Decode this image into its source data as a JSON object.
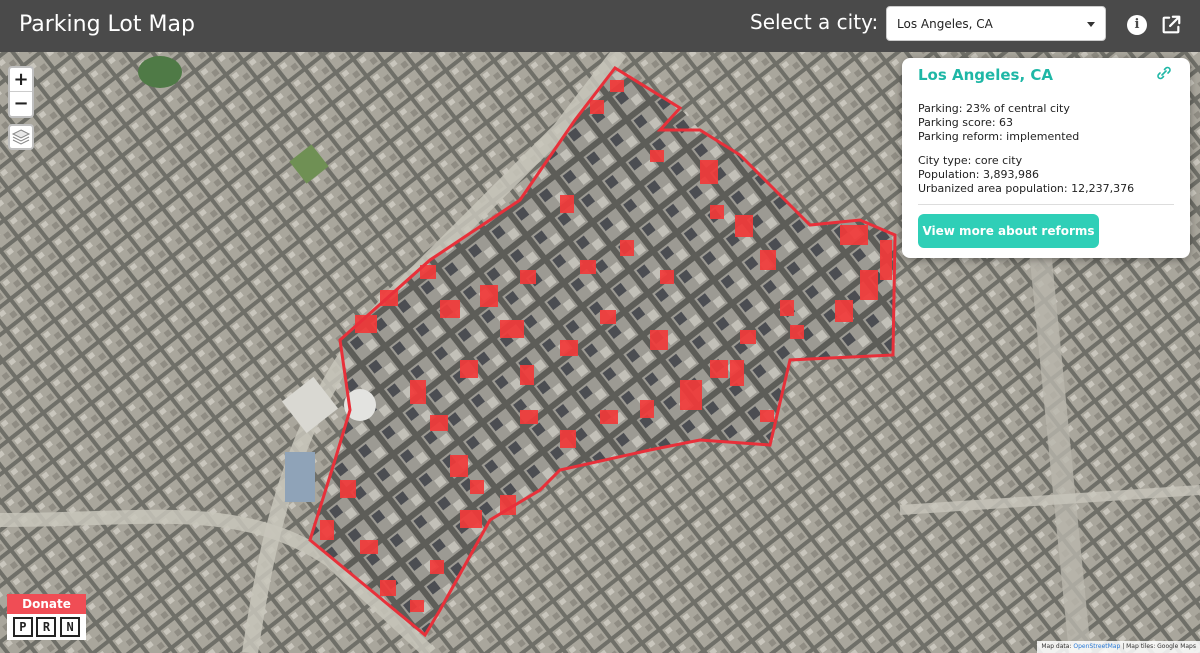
{
  "header": {
    "app_title": "Parking Lot Map",
    "select_label": "Select a city:",
    "selected_city": "Los Angeles, CA",
    "info_icon": "info-icon",
    "share_icon": "external-link-icon"
  },
  "map": {
    "zoom_in_label": "+",
    "zoom_out_label": "−",
    "layers_icon": "layers-icon",
    "boundary_color": "#e8303a",
    "parking_color": "#f23a3a"
  },
  "popup": {
    "title": "Los Angeles, CA",
    "link_icon": "link-icon",
    "parking": "Parking: 23% of central city",
    "parking_score": "Parking score: 63",
    "parking_reform": "Parking reform: implemented",
    "city_type": "City type: core city",
    "population": "Population: 3,893,986",
    "urbanized_population": "Urbanized area population: 12,237,376",
    "button_label": "View more about reforms"
  },
  "footer": {
    "donate_label": "Donate",
    "logo_letters": [
      "P",
      "R",
      "N"
    ],
    "attribution_prefix": "Map data: ",
    "attribution_osm": "OpenStreetMap",
    "attribution_suffix": " | Map tiles: Google Maps"
  },
  "colors": {
    "header_bg": "#4a4a4a",
    "accent": "#1fb7a6",
    "button": "#2fcfb7",
    "donate": "#f04d55"
  }
}
